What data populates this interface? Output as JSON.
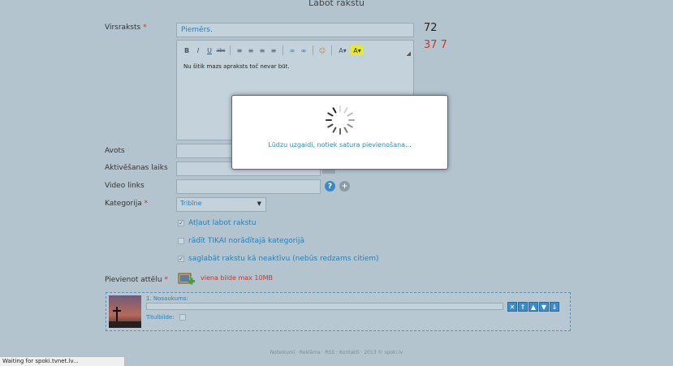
{
  "page": {
    "title": "Labot rakstu"
  },
  "form": {
    "title_label": "Virsraksts",
    "required_mark": "*",
    "title_placeholder": "Piemērs.",
    "editor_text": "Nu šitik mazs apraksts toč nevar būt.",
    "counter_top": "72",
    "counter_bottom": "37 7",
    "source_label": "Avots",
    "activation_label": "Aktivēšanas laiks",
    "video_label": "Video links",
    "category_label": "Kategorija",
    "category_value": "Tribīne",
    "checkboxes": [
      {
        "label": "Atļaut labot rakstu",
        "checked": true
      },
      {
        "label": "rādīt TIKAI norādītajā kategorijā",
        "checked": false
      },
      {
        "label": "saglabāt rakstu kā neaktīvu (nebūs redzams citiem)",
        "checked": true
      }
    ],
    "add_image_label": "Pievienot attēlu",
    "image_hint": "viena bilde max 10MB",
    "image_item": {
      "name_label": "1. Nosaukums:",
      "title_image_label": "Titulbilde:"
    }
  },
  "toolbar": {
    "bold": "B",
    "italic": "I",
    "underline": "U",
    "strike": "abc",
    "font_color": "A",
    "highlight": "A"
  },
  "modal": {
    "message": "Lūdzu uzgaidi, notiek satura pievienošana..."
  },
  "footer": {
    "text": "Noteikumi · Reklāma · RSS · Kontakti · 2013 © spoki.lv"
  },
  "status_bar": {
    "text": "Waiting for spoki.tvnet.lv..."
  },
  "colors": {
    "accent": "#2a8ec1",
    "background": "#b3c4cf",
    "required": "#c0392b"
  }
}
